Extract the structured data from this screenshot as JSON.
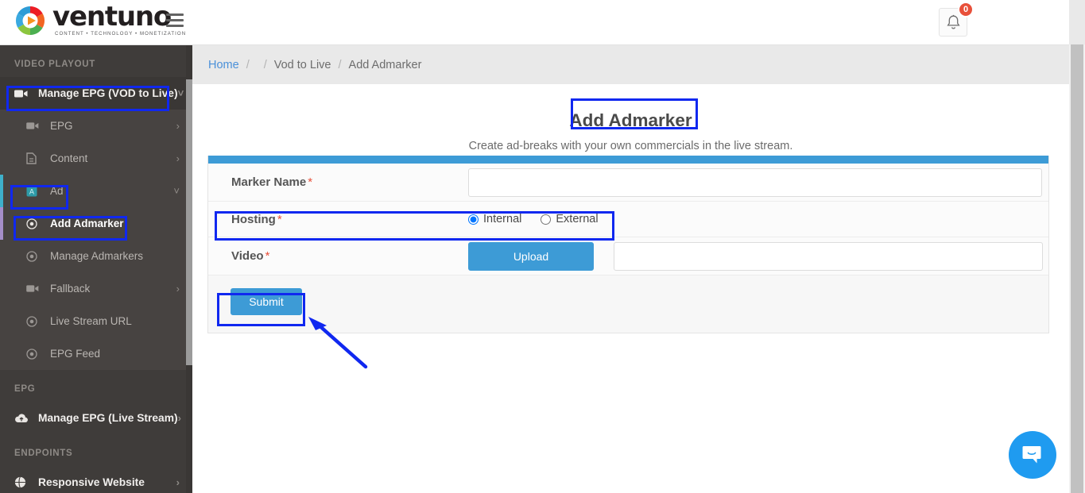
{
  "header": {
    "logo_word": "ventuno",
    "logo_tagline": "CONTENT  •  TECHNOLOGY  •  MONETIZATION",
    "menu_icon": "hamburger-icon",
    "bell_icon": "bell-icon",
    "notification_count": "0"
  },
  "sidebar": {
    "sections": [
      {
        "title": "VIDEO PLAYOUT",
        "items": [
          {
            "label": "Manage EPG (VOD to Live)",
            "icon": "video-camera-icon",
            "caret": "˅",
            "level": "top"
          },
          {
            "label": "EPG",
            "icon": "video-camera-icon",
            "caret": "›",
            "level": "sub"
          },
          {
            "label": "Content",
            "icon": "file-icon",
            "caret": "›",
            "level": "sub"
          },
          {
            "label": "Ad",
            "icon": "ad-badge-icon",
            "caret": "˅",
            "level": "sub"
          },
          {
            "label": "Add Admarker",
            "icon": "radio-dot-icon",
            "caret": "",
            "level": "sub"
          },
          {
            "label": "Manage Admarkers",
            "icon": "radio-dot-icon",
            "caret": "",
            "level": "sub"
          },
          {
            "label": "Fallback",
            "icon": "video-camera-icon",
            "caret": "›",
            "level": "sub"
          },
          {
            "label": "Live Stream URL",
            "icon": "radio-dot-icon",
            "caret": "",
            "level": "sub"
          },
          {
            "label": "EPG Feed",
            "icon": "radio-dot-icon",
            "caret": "",
            "level": "sub"
          }
        ]
      },
      {
        "title": "EPG",
        "items": [
          {
            "label": "Manage EPG (Live Stream)",
            "icon": "cloud-upload-icon",
            "caret": "›",
            "level": "top"
          }
        ]
      },
      {
        "title": "ENDPOINTS",
        "items": [
          {
            "label": "Responsive Website",
            "icon": "globe-icon",
            "caret": "›",
            "level": "top"
          }
        ]
      }
    ]
  },
  "breadcrumb": {
    "home": "Home",
    "sep": "/",
    "blank": "",
    "parent": "Vod to Live",
    "current": "Add Admarker"
  },
  "page": {
    "title": "Add Admarker",
    "subtitle": "Create ad-breaks with your own commercials in the live stream."
  },
  "form": {
    "marker_name": {
      "label": "Marker Name",
      "required": "*",
      "value": "",
      "placeholder": ""
    },
    "hosting": {
      "label": "Hosting",
      "required": "*",
      "options": [
        "Internal",
        "External"
      ],
      "selected": "Internal"
    },
    "video": {
      "label": "Video",
      "required": "*",
      "upload_label": "Upload",
      "value": "",
      "placeholder": ""
    },
    "submit_label": "Submit"
  },
  "chat": {
    "icon": "chat-bubble-icon"
  },
  "colors": {
    "accent_blue": "#3d9bd6",
    "annotation_blue": "#1028f0",
    "sidebar_bg": "#3f3c3a",
    "badge_red": "#e8503a",
    "required_red": "#e8503a",
    "link_blue": "#4a90d9",
    "chat_blue": "#1f9bf0",
    "bar_cyan": "#3eb0ca",
    "bar_purple": "#a58ec9"
  }
}
